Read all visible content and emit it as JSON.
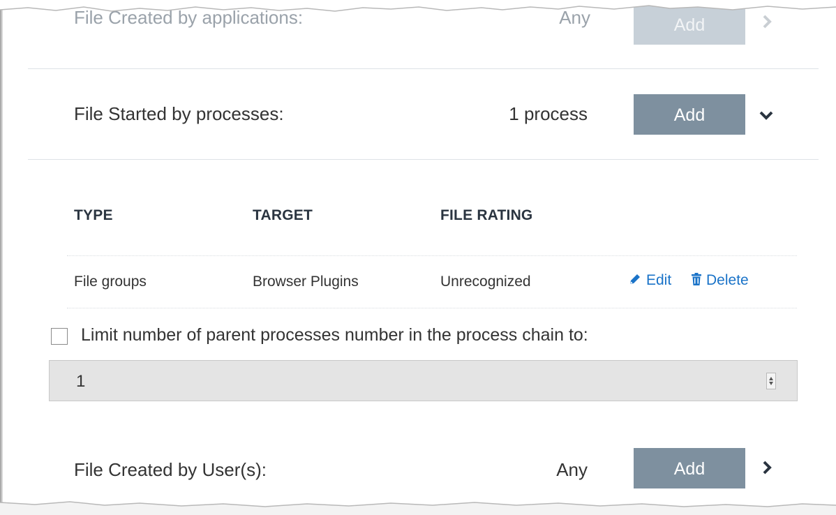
{
  "rows": {
    "created_by_applications": {
      "label": "File Created by applications:",
      "count": "Any",
      "add_label": "Add"
    },
    "started_by_processes": {
      "label": "File Started by processes:",
      "count": "1 process",
      "add_label": "Add"
    },
    "created_by_users": {
      "label": "File Created by User(s):",
      "count": "Any",
      "add_label": "Add"
    }
  },
  "table": {
    "headers": [
      "TYPE",
      "TARGET",
      "FILE RATING"
    ],
    "rows": [
      {
        "type": "File groups",
        "target": "Browser Plugins",
        "file_rating": "Unrecognized",
        "edit_label": "Edit",
        "delete_label": "Delete"
      }
    ]
  },
  "limit_parent": {
    "checked": false,
    "label": "Limit number of parent processes number in the process chain to:",
    "value": "1"
  },
  "colors": {
    "add_button": "#7e909f",
    "link": "#1a73c8",
    "header_text": "#2a3440"
  },
  "icons": {
    "expanded": "chevron-down-icon",
    "collapsed": "chevron-right-icon",
    "edit": "pencil-icon",
    "delete": "trash-icon"
  }
}
